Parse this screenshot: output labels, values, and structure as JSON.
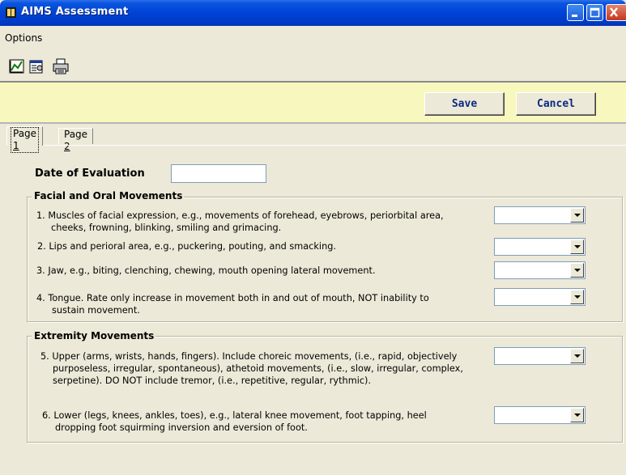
{
  "window": {
    "title": "AIMS Assessment",
    "icon": "app-book-icon",
    "controls": [
      "minimize-icon",
      "maximize-icon",
      "close-icon"
    ]
  },
  "menu": {
    "options_label": "Options"
  },
  "toolbar": {
    "icons": [
      "edit-chart-icon",
      "properties-icon",
      "print-icon"
    ]
  },
  "actions": {
    "save_label": "Save",
    "cancel_label": "Cancel"
  },
  "tabs": [
    {
      "label": "Page ",
      "accesskey": "1",
      "active": true
    },
    {
      "label": "Page ",
      "accesskey": "2",
      "active": false
    }
  ],
  "form": {
    "date_label": "Date of Evaluation",
    "date_value": "",
    "facial_group": {
      "title": "Facial and Oral Movements",
      "items": [
        {
          "lines": [
            "1.  Muscles of facial expression, e.g., movements of forehead, eyebrows, periorbital area,",
            "    cheeks, frowning, blinking, smiling and grimacing."
          ],
          "value": ""
        },
        {
          "lines": [
            "2.  Lips and perioral area, e.g., puckering, pouting, and smacking."
          ],
          "value": ""
        },
        {
          "lines": [
            "3. Jaw, e.g., biting, clenching, chewing, mouth opening lateral movement."
          ],
          "value": ""
        },
        {
          "lines": [
            "4. Tongue.  Rate only increase in movement both in and out of mouth, NOT inability to",
            "    sustain movement."
          ],
          "value": ""
        }
      ]
    },
    "extremity_group": {
      "title": "Extremity Movements",
      "items": [
        {
          "lines": [
            "5.  Upper (arms, wrists, hands, fingers).  Include choreic movements, (i.e., rapid, objectively",
            "     purposeless, irregular, spontaneous), athetoid movements, (i.e., slow, irregular, complex,",
            "     serpetine).  DO NOT include tremor, (i.e., repetitive, regular, rythmic)."
          ],
          "value": ""
        },
        {
          "lines": [
            "6.  Lower (legs, knees, ankles, toes), e.g., lateral knee movement, foot tapping, heel",
            "     dropping foot squirming inversion and eversion of foot."
          ],
          "value": ""
        }
      ]
    }
  },
  "colors": {
    "titlebar": "#0042d6",
    "face": "#ECE9D8",
    "action_band": "#F8F8BE",
    "button_text": "#0b2a80"
  }
}
